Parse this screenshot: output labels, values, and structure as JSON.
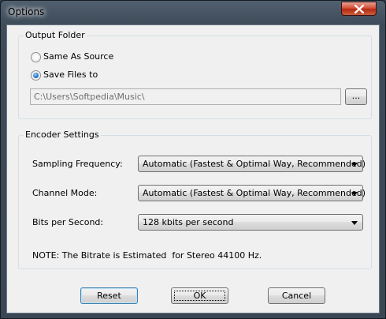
{
  "window": {
    "title": "Options"
  },
  "output_folder": {
    "legend": "Output Folder",
    "options": [
      {
        "label": "Same As Source",
        "selected": false
      },
      {
        "label": "Save Files to",
        "selected": true
      }
    ],
    "path": "C:\\Users\\Softpedia\\Music\\",
    "browse_label": "..."
  },
  "encoder_settings": {
    "legend": "Encoder Settings",
    "fields": [
      {
        "label": "Sampling Frequency:",
        "value": "Automatic (Fastest & Optimal Way, Recommended)"
      },
      {
        "label": "Channel Mode:",
        "value": "Automatic (Fastest & Optimal Way, Recommended)"
      },
      {
        "label": "Bits per Second:",
        "value": "128 kbits per second"
      }
    ],
    "note": "NOTE: The Bitrate is Estimated  for Stereo 44100 Hz."
  },
  "buttons": {
    "reset": "Reset",
    "ok": "OK",
    "cancel": "Cancel"
  },
  "icons": {
    "close": "close-icon",
    "dropdown": "chevron-down-icon"
  }
}
